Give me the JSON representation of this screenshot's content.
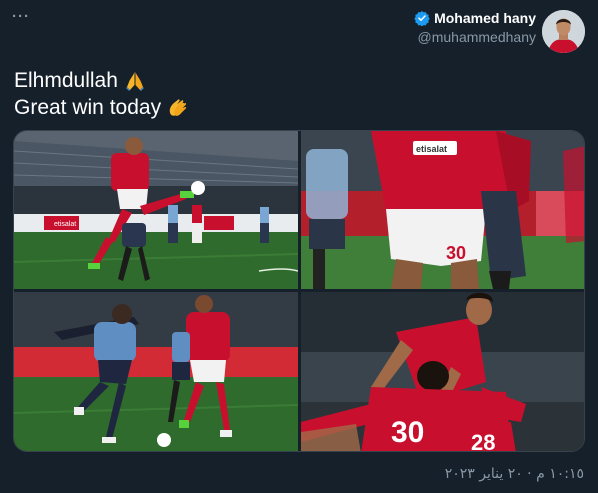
{
  "header": {
    "more_label": "···",
    "display_name": "Mohamed hany",
    "handle": "@muhammedhany"
  },
  "tweet": {
    "line1": "Elhmdullah",
    "line2": "Great win today",
    "line1_emoji": "folded-hands",
    "line2_emoji": "clapping-hands"
  },
  "media": {
    "photos": [
      {
        "sponsor": "etisalat"
      },
      {
        "sponsor": "etisalat",
        "shirt_number": "30"
      },
      {},
      {
        "shirt_number_a": "30",
        "shirt_number_b": "28"
      }
    ]
  },
  "footer": {
    "timestamp": "١٠:١٥ م · ٢٠ يناير ٢٠٢٣"
  },
  "colors": {
    "background": "#15202b",
    "secondary_text": "#8899a6",
    "verified_badge": "#1d9bf0",
    "kit_red": "#c8102e",
    "pitch_green": "#2f6b2c"
  }
}
